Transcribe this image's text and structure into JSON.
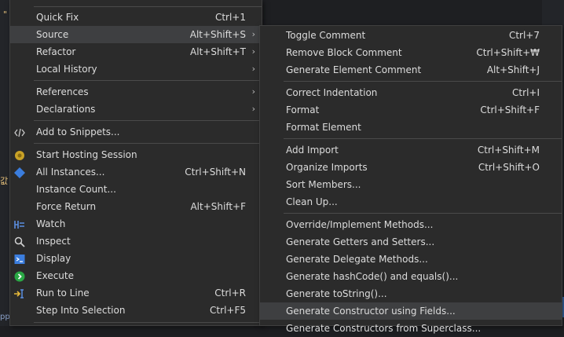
{
  "main_menu": {
    "items": [
      {
        "label": "Quick Fix",
        "shortcut": "Ctrl+1"
      },
      {
        "label": "Source",
        "shortcut": "Alt+Shift+S",
        "arrow": "›"
      },
      {
        "label": "Refactor",
        "shortcut": "Alt+Shift+T",
        "arrow": "›"
      },
      {
        "label": "Local History",
        "arrow": "›"
      },
      {
        "label": "References",
        "arrow": "›"
      },
      {
        "label": "Declarations",
        "arrow": "›"
      },
      {
        "label": "Add to Snippets..."
      },
      {
        "label": "Start Hosting Session"
      },
      {
        "label": "All Instances...",
        "shortcut": "Ctrl+Shift+N"
      },
      {
        "label": "Instance Count..."
      },
      {
        "label": "Force Return",
        "shortcut": "Alt+Shift+F"
      },
      {
        "label": "Watch"
      },
      {
        "label": "Inspect"
      },
      {
        "label": "Display"
      },
      {
        "label": "Execute"
      },
      {
        "label": "Run to Line",
        "shortcut": "Ctrl+R"
      },
      {
        "label": "Step Into Selection",
        "shortcut": "Ctrl+F5"
      }
    ]
  },
  "source_submenu": {
    "items": [
      {
        "label": "Toggle Comment",
        "shortcut": "Ctrl+7"
      },
      {
        "label": "Remove Block Comment",
        "shortcut": "Ctrl+Shift+₩"
      },
      {
        "label": "Generate Element Comment",
        "shortcut": "Alt+Shift+J"
      },
      {
        "label": "Correct Indentation",
        "shortcut": "Ctrl+I"
      },
      {
        "label": "Format",
        "shortcut": "Ctrl+Shift+F"
      },
      {
        "label": "Format Element"
      },
      {
        "label": "Add Import",
        "shortcut": "Ctrl+Shift+M"
      },
      {
        "label": "Organize Imports",
        "shortcut": "Ctrl+Shift+O"
      },
      {
        "label": "Sort Members..."
      },
      {
        "label": "Clean Up..."
      },
      {
        "label": "Override/Implement Methods..."
      },
      {
        "label": "Generate Getters and Setters..."
      },
      {
        "label": "Generate Delegate Methods..."
      },
      {
        "label": "Generate hashCode() and equals()..."
      },
      {
        "label": "Generate toString()..."
      },
      {
        "label": "Generate Constructor using Fields..."
      },
      {
        "label": "Generate Constructors from Superclass..."
      }
    ]
  },
  "editor": {
    "mark1": "\"",
    "mark2": "값",
    "mark3": "pp"
  },
  "colors": {
    "accent_blue": "#3b7ddd",
    "execute_green": "#2aa845",
    "hosting_yellow": "#c9a227"
  }
}
